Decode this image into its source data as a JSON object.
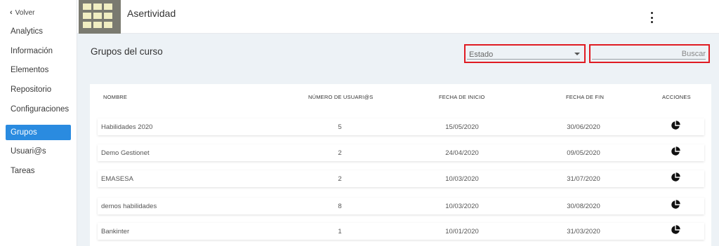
{
  "sidebar": {
    "back_label": "Volver",
    "items": [
      {
        "label": "Analytics",
        "active": false
      },
      {
        "label": "Información",
        "active": false
      },
      {
        "label": "Elementos",
        "active": false
      },
      {
        "label": "Repositorio",
        "active": false
      },
      {
        "label": "Configuraciones",
        "active": false
      },
      {
        "label": "Grupos",
        "active": true
      },
      {
        "label": "Usuari@s",
        "active": false
      },
      {
        "label": "Tareas",
        "active": false
      }
    ]
  },
  "header": {
    "course_title": "Asertividad",
    "menu_icon": "more-vertical-icon"
  },
  "main": {
    "title": "Grupos del curso",
    "status_filter": {
      "value": "Estado"
    },
    "search": {
      "placeholder": "Buscar",
      "value": ""
    }
  },
  "table": {
    "columns": [
      "NOMBRE",
      "NÚMERO DE USUARI@S",
      "FECHA DE INICIO",
      "FECHA DE FIN",
      "ACCIONES"
    ],
    "rows": [
      {
        "name": "Habilidades 2020",
        "users": "5",
        "start": "15/05/2020",
        "end": "30/06/2020",
        "action_icon": "pie-chart-icon"
      },
      {
        "name": "Demo Gestionet",
        "users": "2",
        "start": "24/04/2020",
        "end": "09/05/2020",
        "action_icon": "pie-chart-icon"
      },
      {
        "name": "EMASESA",
        "users": "2",
        "start": "10/03/2020",
        "end": "31/07/2020",
        "action_icon": "pie-chart-icon"
      },
      {
        "name": "demos habilidades",
        "users": "8",
        "start": "10/03/2020",
        "end": "30/08/2020",
        "action_icon": "pie-chart-icon"
      },
      {
        "name": "Bankinter",
        "users": "1",
        "start": "10/01/2020",
        "end": "31/03/2020",
        "action_icon": "pie-chart-icon"
      }
    ]
  },
  "colors": {
    "accent": "#2a8be0",
    "highlight": "#e01b22",
    "background": "#edf2f6"
  }
}
